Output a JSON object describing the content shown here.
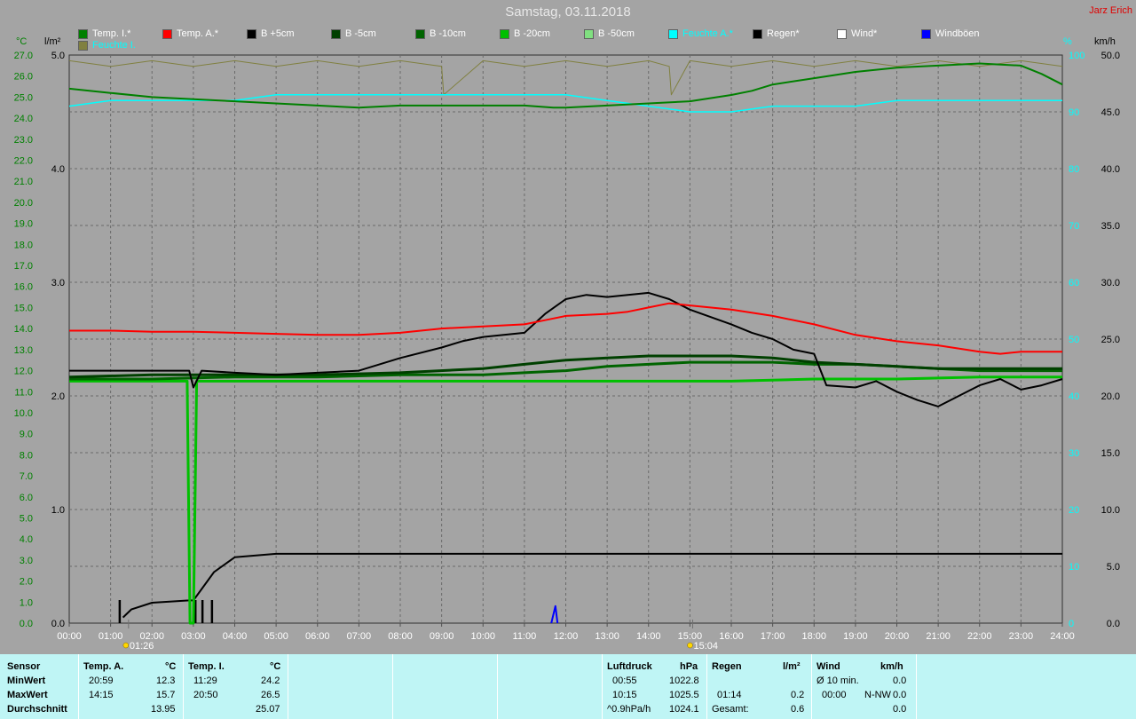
{
  "header": {
    "title": "Samstag, 03.11.2018",
    "author": "Jarz Erich"
  },
  "legend": [
    {
      "label": "Temp. I.*",
      "color": "#008000"
    },
    {
      "label": "Temp. A.*",
      "color": "#ff0000"
    },
    {
      "label": "B +5cm",
      "color": "#000000"
    },
    {
      "label": "B -5cm",
      "color": "#004000"
    },
    {
      "label": "B -10cm",
      "color": "#006400"
    },
    {
      "label": "B -20cm",
      "color": "#00c000"
    },
    {
      "label": "B -50cm",
      "color": "#80e080"
    },
    {
      "label": "Feuchte A.*",
      "color": "#00ffff"
    },
    {
      "label": "Regen*",
      "color": "#000000"
    },
    {
      "label": "Wind*",
      "color": "#ffffff"
    },
    {
      "label": "Windböen",
      "color": "#0000ff"
    },
    {
      "label": "Feuchte I.",
      "color": "#808040"
    }
  ],
  "axis_units": {
    "temp": "°C",
    "rain": "l/m²",
    "humidity": "%",
    "wind": "km/h"
  },
  "chart_data": {
    "type": "line",
    "title": "Samstag, 03.11.2018",
    "x_ticks": [
      "00:00",
      "01:00",
      "02:00",
      "03:00",
      "04:00",
      "05:00",
      "06:00",
      "07:00",
      "08:00",
      "09:00",
      "10:00",
      "11:00",
      "12:00",
      "13:00",
      "14:00",
      "15:00",
      "16:00",
      "17:00",
      "18:00",
      "19:00",
      "20:00",
      "21:00",
      "22:00",
      "23:00",
      "24:00"
    ],
    "xlim": [
      0,
      24
    ],
    "y_temp_ticks": [
      "0.0",
      "1.0",
      "2.0",
      "3.0",
      "4.0",
      "5.0",
      "6.0",
      "7.0",
      "8.0",
      "9.0",
      "10.0",
      "11.0",
      "12.0",
      "13.0",
      "14.0",
      "15.0",
      "16.0",
      "17.0",
      "18.0",
      "19.0",
      "20.0",
      "21.0",
      "22.0",
      "23.0",
      "24.0",
      "25.0",
      "26.0",
      "27.0"
    ],
    "ylim_temp": [
      0,
      27
    ],
    "y_rain_ticks": [
      "0.0",
      "1.0",
      "2.0",
      "3.0",
      "4.0",
      "5.0"
    ],
    "ylim_rain": [
      0,
      5
    ],
    "y_hum_ticks": [
      "0",
      "10",
      "20",
      "30",
      "40",
      "50",
      "60",
      "70",
      "80",
      "90",
      "100"
    ],
    "ylim_hum": [
      0,
      100
    ],
    "y_wind_ticks": [
      "0.0",
      "5.0",
      "10.0",
      "15.0",
      "20.0",
      "25.0",
      "30.0",
      "35.0",
      "40.0",
      "45.0",
      "50.0"
    ],
    "ylim_wind": [
      0,
      50
    ],
    "sun_markers": [
      "01:26",
      "15:04"
    ],
    "series": [
      {
        "name": "Temp. I.*",
        "axis": "temp",
        "color": "#008000",
        "x": [
          0,
          1,
          2,
          3,
          4,
          5,
          6,
          7,
          8,
          9,
          10,
          11,
          11.7,
          12,
          13,
          14,
          15,
          16,
          16.5,
          17,
          18,
          19,
          20,
          21,
          22,
          23,
          23.5,
          24
        ],
        "y": [
          25.4,
          25.2,
          25.0,
          24.9,
          24.8,
          24.7,
          24.6,
          24.5,
          24.6,
          24.6,
          24.6,
          24.6,
          24.5,
          24.5,
          24.6,
          24.7,
          24.8,
          25.1,
          25.3,
          25.6,
          25.9,
          26.2,
          26.4,
          26.5,
          26.6,
          26.5,
          26.1,
          25.6
        ]
      },
      {
        "name": "Temp. A.*",
        "axis": "temp",
        "color": "#ff0000",
        "x": [
          0,
          1,
          2,
          3,
          4,
          5,
          6,
          7,
          8,
          9,
          10,
          11,
          11.5,
          12,
          13,
          13.5,
          14,
          14.5,
          15,
          16,
          17,
          18,
          19,
          20,
          21,
          22,
          22.5,
          23,
          24
        ],
        "y": [
          13.9,
          13.9,
          13.85,
          13.85,
          13.8,
          13.75,
          13.7,
          13.7,
          13.8,
          14.0,
          14.1,
          14.2,
          14.4,
          14.6,
          14.7,
          14.8,
          15.0,
          15.2,
          15.1,
          14.9,
          14.6,
          14.2,
          13.7,
          13.4,
          13.2,
          12.9,
          12.8,
          12.9,
          12.9
        ]
      },
      {
        "name": "B +5cm",
        "axis": "temp",
        "color": "#000000",
        "x": [
          0,
          1,
          2,
          2.9,
          3.0,
          3.2,
          4,
          5,
          6,
          7,
          7.5,
          8,
          9,
          9.5,
          10,
          10.5,
          11,
          11.5,
          12,
          12.5,
          13,
          13.5,
          14,
          14.5,
          15,
          16,
          16.5,
          17,
          17.5,
          18,
          18.3,
          19,
          19.5,
          20,
          20.5,
          21,
          21.5,
          22,
          22.5,
          23,
          23.5,
          24
        ],
        "y": [
          12.0,
          12.0,
          12.0,
          12.0,
          11.2,
          12.0,
          11.9,
          11.8,
          11.9,
          12.0,
          12.3,
          12.6,
          13.1,
          13.4,
          13.6,
          13.7,
          13.8,
          14.7,
          15.4,
          15.6,
          15.5,
          15.6,
          15.7,
          15.4,
          14.9,
          14.2,
          13.8,
          13.5,
          13.0,
          12.8,
          11.3,
          11.2,
          11.5,
          11.0,
          10.6,
          10.3,
          10.8,
          11.3,
          11.6,
          11.1,
          11.3,
          11.6
        ]
      },
      {
        "name": "B -5cm",
        "axis": "temp",
        "color": "#004000",
        "x": [
          0,
          2,
          4,
          6,
          8,
          10,
          11,
          12,
          13,
          14,
          15,
          16,
          17,
          18,
          19,
          20,
          21,
          22,
          23,
          24
        ],
        "y": [
          11.7,
          11.8,
          11.8,
          11.8,
          11.9,
          12.1,
          12.3,
          12.5,
          12.6,
          12.7,
          12.7,
          12.7,
          12.6,
          12.4,
          12.3,
          12.2,
          12.1,
          12.1,
          12.1,
          12.1
        ]
      },
      {
        "name": "B -10cm",
        "axis": "temp",
        "color": "#006400",
        "x": [
          0,
          2,
          4,
          6,
          8,
          10,
          11,
          12,
          13,
          14,
          15,
          16,
          17,
          18,
          19,
          20,
          21,
          22,
          23,
          24
        ],
        "y": [
          11.6,
          11.6,
          11.7,
          11.7,
          11.8,
          11.8,
          11.9,
          12.0,
          12.2,
          12.3,
          12.4,
          12.4,
          12.4,
          12.3,
          12.3,
          12.2,
          12.1,
          12.0,
          12.0,
          12.0
        ]
      },
      {
        "name": "B -20cm",
        "axis": "temp",
        "color": "#00c000",
        "x": [
          0,
          1,
          2,
          2.85,
          2.92,
          3.0,
          3.08,
          4,
          6,
          8,
          10,
          12,
          14,
          16,
          18,
          20,
          22,
          23,
          24
        ],
        "y": [
          11.5,
          11.5,
          11.5,
          11.5,
          0.0,
          0.0,
          11.5,
          11.5,
          11.5,
          11.5,
          11.5,
          11.5,
          11.5,
          11.5,
          11.6,
          11.6,
          11.7,
          11.7,
          11.7
        ]
      },
      {
        "name": "Feuchte A.*",
        "axis": "humidity",
        "color": "#00ffff",
        "x": [
          0,
          1,
          2,
          3,
          4,
          5,
          6,
          7,
          8,
          9,
          10,
          11,
          12,
          13,
          14,
          15,
          16,
          17,
          18,
          19,
          20,
          21,
          22,
          23,
          24
        ],
        "y": [
          91,
          92,
          92,
          92,
          92,
          93,
          93,
          93,
          93,
          93,
          93,
          93,
          93,
          92,
          91,
          90,
          90,
          91,
          91,
          91,
          92,
          92,
          92,
          92,
          92
        ]
      },
      {
        "name": "Feuchte I.",
        "axis": "humidity",
        "color": "#808040",
        "x": [
          0,
          1,
          2,
          3,
          4,
          5,
          6,
          7,
          8,
          9,
          9.05,
          10,
          11,
          12,
          13,
          14,
          14.5,
          14.55,
          15,
          16,
          17,
          18,
          19,
          20,
          21,
          22,
          23,
          24
        ],
        "y": [
          99,
          98,
          99,
          98,
          99,
          98,
          99,
          98,
          99,
          98,
          93,
          99,
          98,
          99,
          98,
          99,
          98,
          93,
          99,
          98,
          99,
          98,
          99,
          98,
          99,
          98,
          99,
          98
        ]
      },
      {
        "name": "Regen*",
        "axis": "rain",
        "color": "#000000",
        "x": [
          1.3,
          1.5,
          2,
          2.9,
          3.0,
          3.2,
          3.5,
          4,
          5,
          6,
          8,
          10,
          12,
          14,
          16,
          18,
          20,
          22,
          24
        ],
        "y": [
          0.05,
          0.12,
          0.18,
          0.2,
          0.2,
          0.3,
          0.45,
          0.58,
          0.61,
          0.61,
          0.61,
          0.61,
          0.61,
          0.61,
          0.61,
          0.61,
          0.61,
          0.61,
          0.61
        ]
      },
      {
        "name": "Windböen",
        "axis": "wind",
        "color": "#0000ff",
        "x": [
          11.65,
          11.75,
          11.8
        ],
        "y": [
          0.0,
          1.5,
          0.0
        ]
      }
    ]
  },
  "table": {
    "sensor_col": {
      "header": "Sensor",
      "min": "MinWert",
      "max": "MaxWert",
      "avg": "Durchschnitt"
    },
    "temp_a": {
      "header": "Temp. A.",
      "unit": "°C",
      "min_time": "20:59",
      "min_val": "12.3",
      "max_time": "14:15",
      "max_val": "15.7",
      "avg_val": "13.95"
    },
    "temp_i": {
      "header": "Temp. I.",
      "unit": "°C",
      "min_time": "11:29",
      "min_val": "24.2",
      "max_time": "20:50",
      "max_val": "26.5",
      "avg_val": "25.07"
    },
    "pressure": {
      "header": "Luftdruck",
      "unit": "hPa",
      "min_time": "00:55",
      "min_val": "1022.8",
      "max_time": "10:15",
      "max_val": "1025.5",
      "trend_label": "^0.9hPa/h",
      "trend_val": "1024.1"
    },
    "rain": {
      "header": "Regen",
      "unit": "l/m²",
      "r2_time": "01:14",
      "r2_val": "0.2",
      "total_label": "Gesamt:",
      "total_val": "0.6"
    },
    "wind": {
      "header": "Wind",
      "unit": "km/h",
      "avg_label": "Ø 10 min.",
      "avg_val": "0.0",
      "r2_time": "00:00",
      "r2_dir": "N-NW",
      "r2_val": "0.0",
      "r3_val": "0.0"
    }
  }
}
